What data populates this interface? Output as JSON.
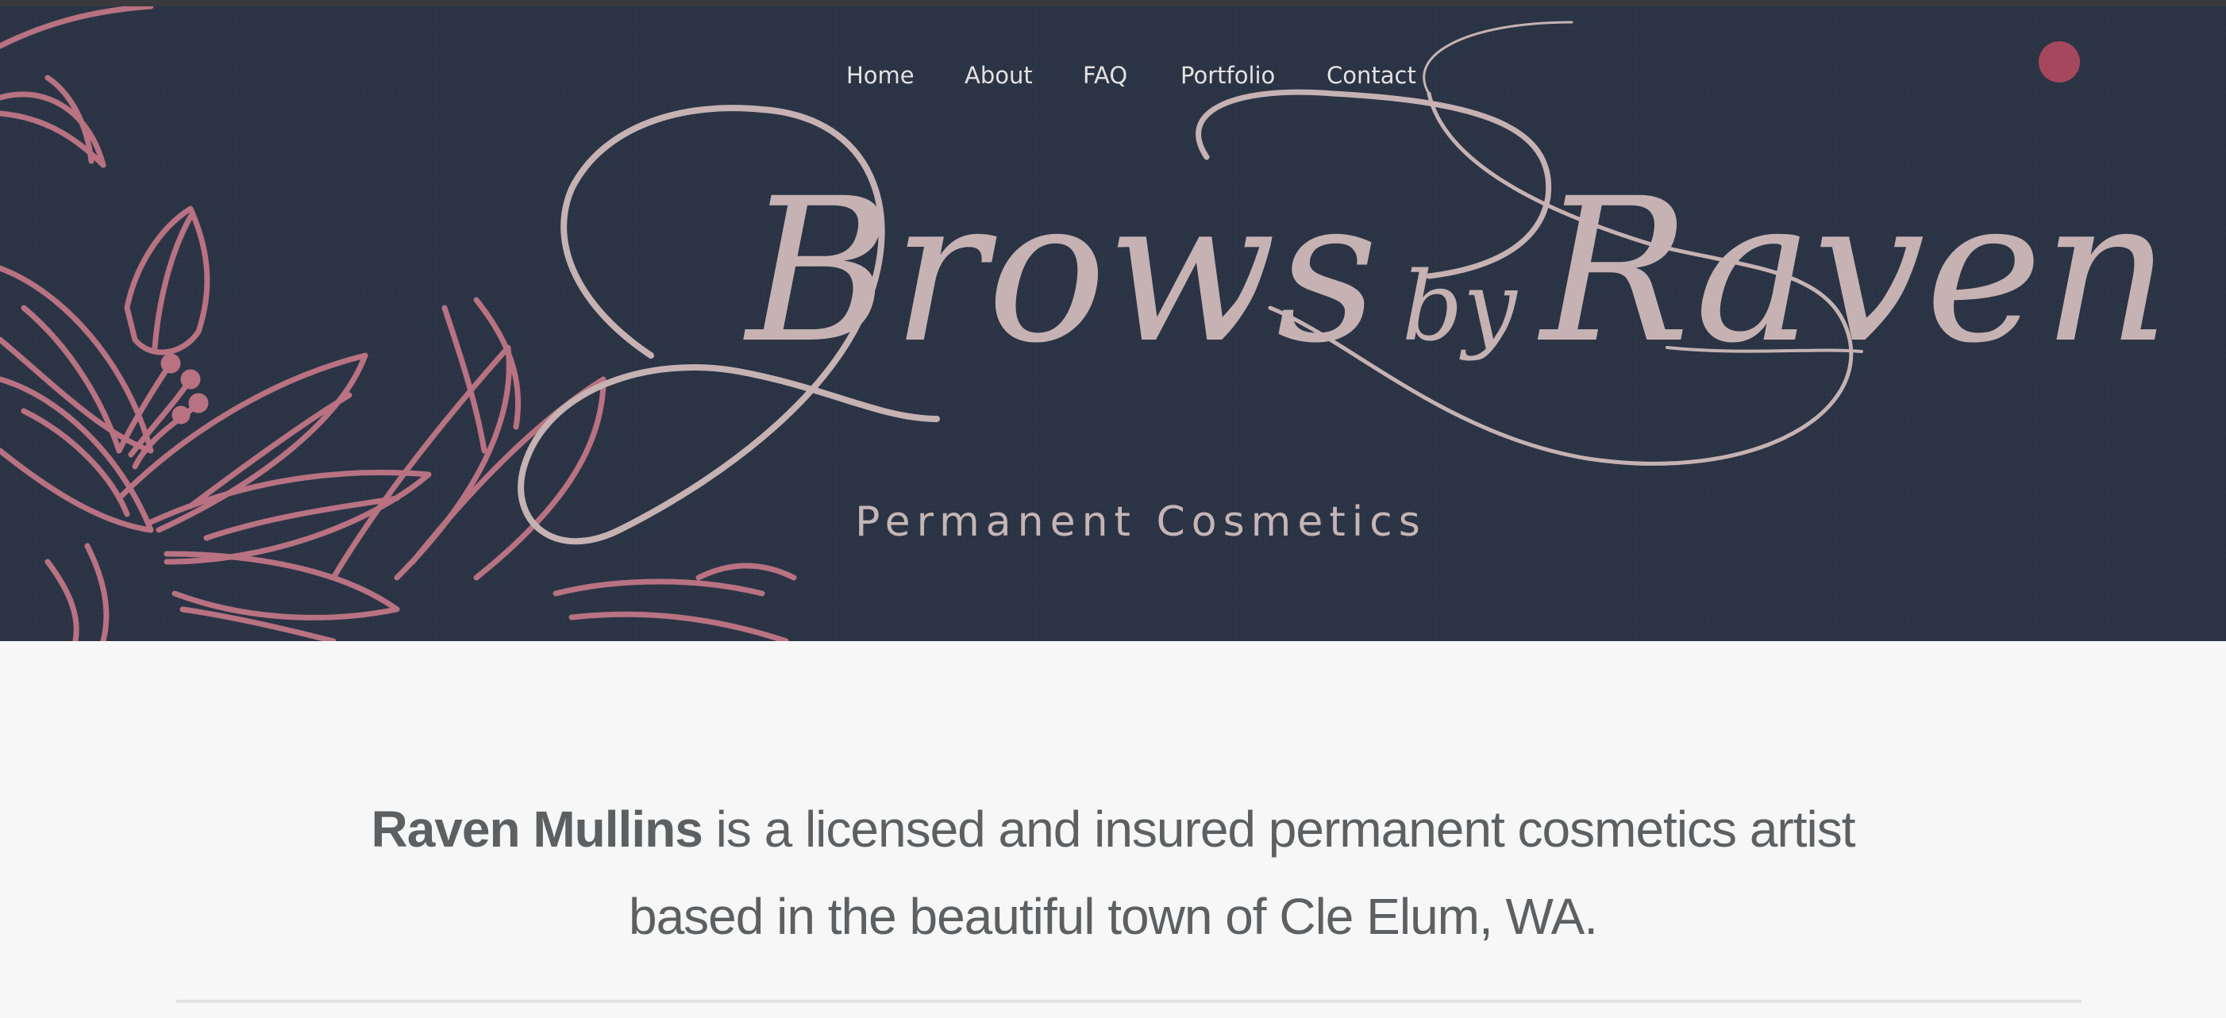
{
  "nav": {
    "items": [
      {
        "label": "Home"
      },
      {
        "label": "About"
      },
      {
        "label": "FAQ"
      },
      {
        "label": "Portfolio"
      },
      {
        "label": "Contact"
      }
    ]
  },
  "brand": {
    "logo_text": "Brows by Raven",
    "tagline": "Permanent Cosmetics"
  },
  "intro": {
    "name": "Raven Mullins",
    "line1_rest": " is a licensed and insured permanent cosmetics artist",
    "line2": "based in the beautiful town of Cle Elum, WA."
  },
  "colors": {
    "hero_bg": "#2b3445",
    "floral": "#b87282",
    "logo": "#c6b2b3",
    "accent_dot": "#a5485d",
    "page_bg": "#f6f7f6",
    "text": "#5c6063"
  }
}
